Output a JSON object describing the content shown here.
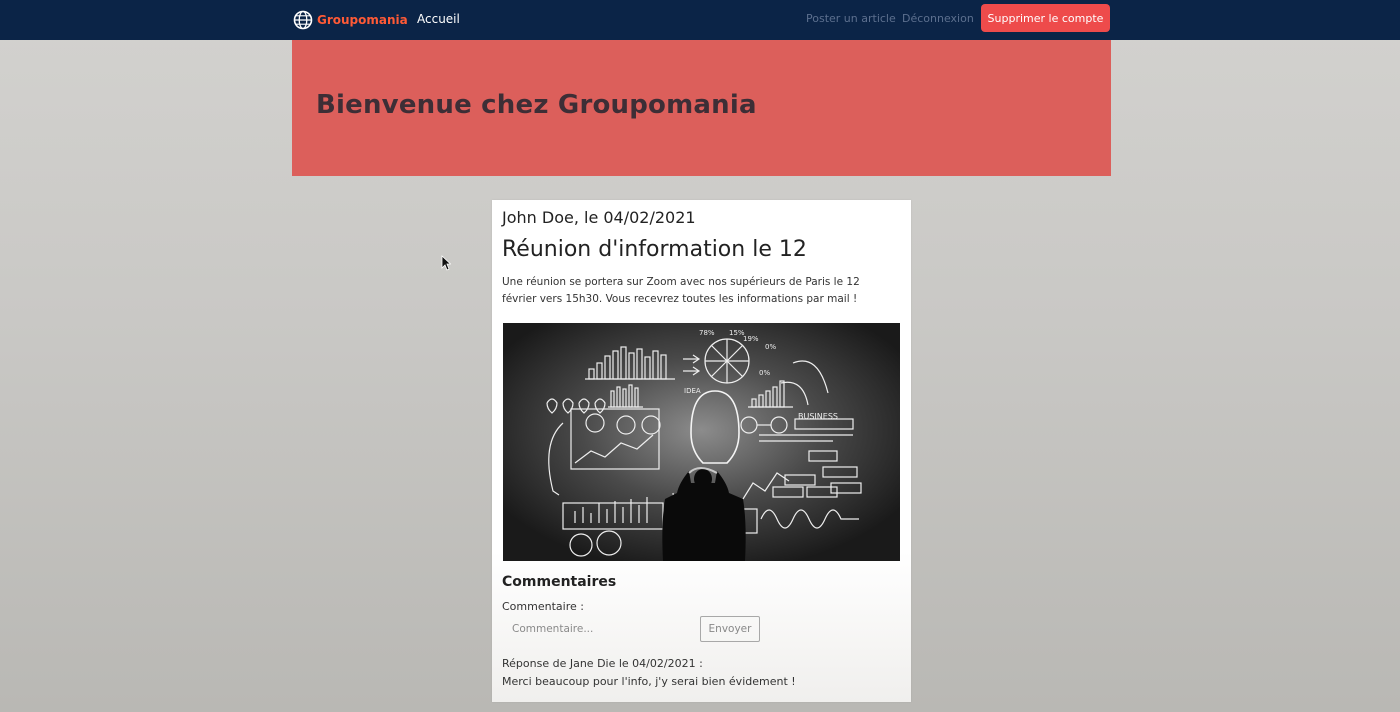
{
  "navbar": {
    "brand": "Groupomania",
    "home_label": "Accueil",
    "post_label": "Poster un article",
    "logout_label": "Déconnexion",
    "delete_account_label": "Supprimer le compte"
  },
  "hero": {
    "title": "Bienvenue chez Groupomania"
  },
  "post": {
    "author_line": "John Doe, le 04/02/2021",
    "title": "Réunion d'information le 12",
    "body": "Une réunion se portera sur Zoom avec nos supérieurs de Paris le 12 février vers 15h30. Vous recevrez toutes les informations par mail !",
    "image_labels": {
      "pct_a": "78%",
      "pct_b": "15%",
      "pct_c": "19%",
      "pct_d": "0%",
      "pct_e": "0%",
      "idea": "IDEA",
      "business": "BUSINESS"
    }
  },
  "comments": {
    "heading": "Commentaires",
    "field_label": "Commentaire :",
    "input_placeholder": "Commentaire...",
    "send_label": "Envoyer",
    "replies": [
      {
        "header": "Réponse de Jane Die le 04/02/2021 :",
        "text": "Merci beaucoup pour l'info, j'y serai bien évidement !"
      }
    ]
  },
  "colors": {
    "navbar_bg": "#0b2447",
    "brand": "#ff5a36",
    "delete_button": "#ee4b4b",
    "hero_bg": "#dc5f5b",
    "page_bg": "#cfcecb"
  },
  "icons": {
    "brand": "globe-icon",
    "pointer": "mouse-cursor-icon"
  }
}
